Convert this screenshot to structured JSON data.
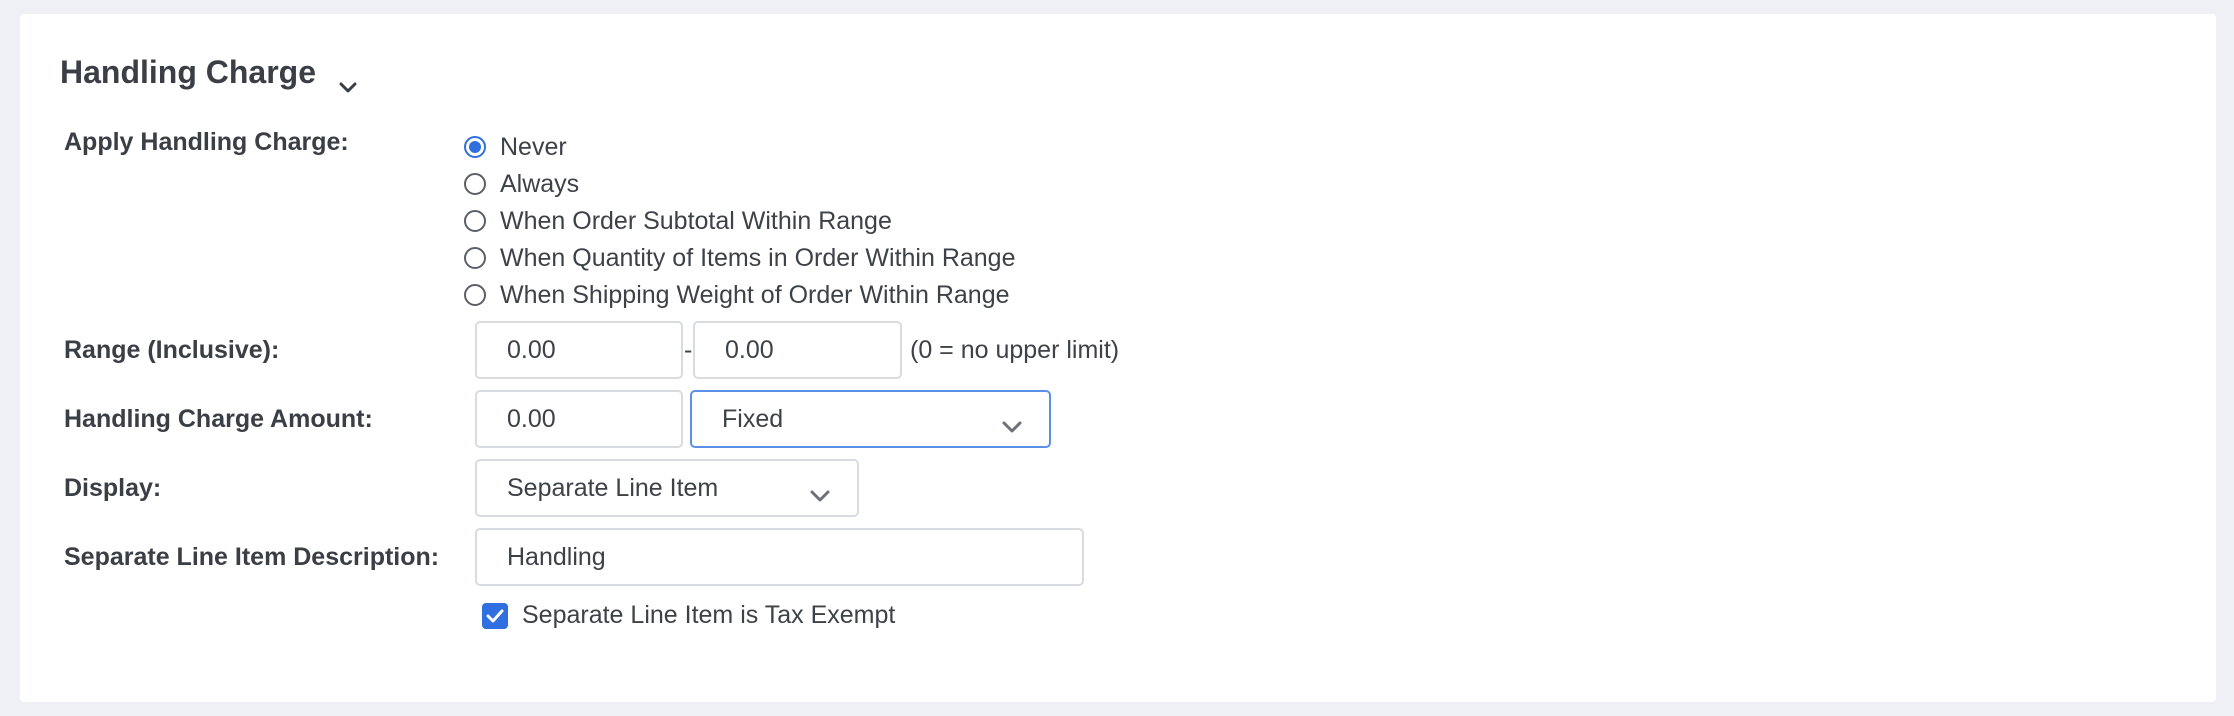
{
  "section": {
    "title": "Handling Charge",
    "toggle_icon": "chevron-down-icon"
  },
  "apply": {
    "label": "Apply Handling Charge:",
    "options": [
      {
        "label": "Never",
        "checked": true
      },
      {
        "label": "Always",
        "checked": false
      },
      {
        "label": "When Order Subtotal Within Range",
        "checked": false
      },
      {
        "label": "When Quantity of Items in Order Within Range",
        "checked": false
      },
      {
        "label": "When Shipping Weight of Order Within Range",
        "checked": false
      }
    ]
  },
  "range": {
    "label": "Range (Inclusive):",
    "min_value": "0.00",
    "separator": "-",
    "max_value": "0.00",
    "hint": "(0 = no upper limit)"
  },
  "amount": {
    "label": "Handling Charge Amount:",
    "value": "0.00",
    "type_selected": "Fixed"
  },
  "display": {
    "label": "Display:",
    "selected": "Separate Line Item"
  },
  "description": {
    "label": "Separate Line Item Description:",
    "value": "Handling"
  },
  "tax_exempt": {
    "label": "Separate Line Item is Tax Exempt",
    "checked": true
  },
  "colors": {
    "accent": "#2f6fe0",
    "border": "#d8dbe0",
    "background": "#eef0f5"
  }
}
